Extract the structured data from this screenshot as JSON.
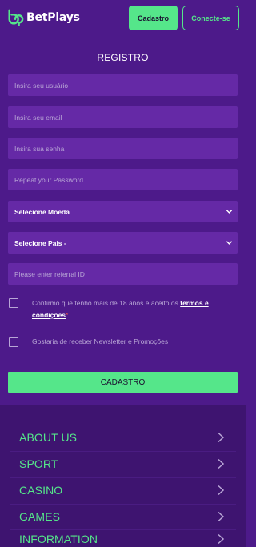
{
  "header": {
    "brand": "BetPlays",
    "cadastro_label": "Cadastro",
    "conecte_label": "Conecte-se"
  },
  "form": {
    "title": "REGISTRO",
    "username_placeholder": "Insira seu usuário",
    "email_placeholder": "Insira seu email",
    "password_placeholder": "Insira sua senha",
    "repeat_password_placeholder": "Repeat your Password",
    "currency_select": "Selecione Moeda",
    "country_select": "Selecione Pais -",
    "referral_placeholder": "Please enter referral ID",
    "terms_text": "Confirmo que tenho mais de 18 anos e aceito os ",
    "terms_link": "termos e condições",
    "terms_required_mark": "*",
    "newsletter_text": "Gostaria de receber Newsletter e Promoções",
    "submit_label": "CADASTRO"
  },
  "footer": {
    "items": [
      {
        "label": "ABOUT US"
      },
      {
        "label": "SPORT"
      },
      {
        "label": "CASINO"
      },
      {
        "label": "GAMES"
      },
      {
        "label": "INFORMATION"
      }
    ]
  },
  "colors": {
    "background": "#4d1a8a",
    "field": "#6529a6",
    "accent_green": "#55e68a",
    "footer_bg": "#3e1470"
  },
  "icons": {
    "logo": "betplays-logo-icon",
    "select_arrow": "chevron-down-icon",
    "footer_arrow": "chevron-right-icon"
  }
}
